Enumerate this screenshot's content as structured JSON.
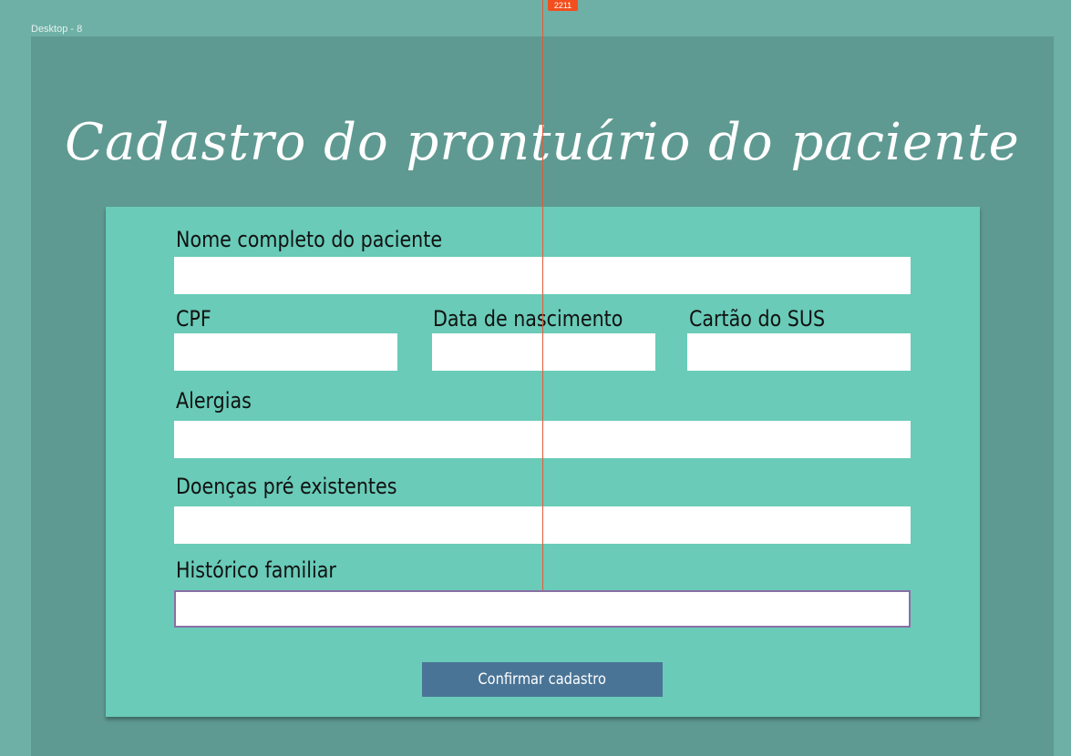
{
  "frame": {
    "label": "Desktop - 8"
  },
  "page": {
    "title": "Cadastro do prontuário do paciente"
  },
  "form": {
    "full_name": {
      "label": "Nome completo do paciente",
      "value": ""
    },
    "cpf": {
      "label": "CPF",
      "value": ""
    },
    "birth_date": {
      "label": "Data de nascimento",
      "value": ""
    },
    "sus_card": {
      "label": "Cartão do SUS",
      "value": ""
    },
    "allergies": {
      "label": "Alergias",
      "value": ""
    },
    "preexisting_conditions": {
      "label": "Doenças pré existentes",
      "value": ""
    },
    "family_history": {
      "label": "Histórico familiar",
      "value": ""
    },
    "submit_label": "Confirmar cadastro"
  },
  "guide": {
    "badge": "2211"
  },
  "colors": {
    "background": "#6fb0a6",
    "canvas": "#5f9a92",
    "form_card": "#69cbb8",
    "button": "#4a7496",
    "guide": "#f24e1e",
    "focus_border": "#8a6fa6"
  }
}
